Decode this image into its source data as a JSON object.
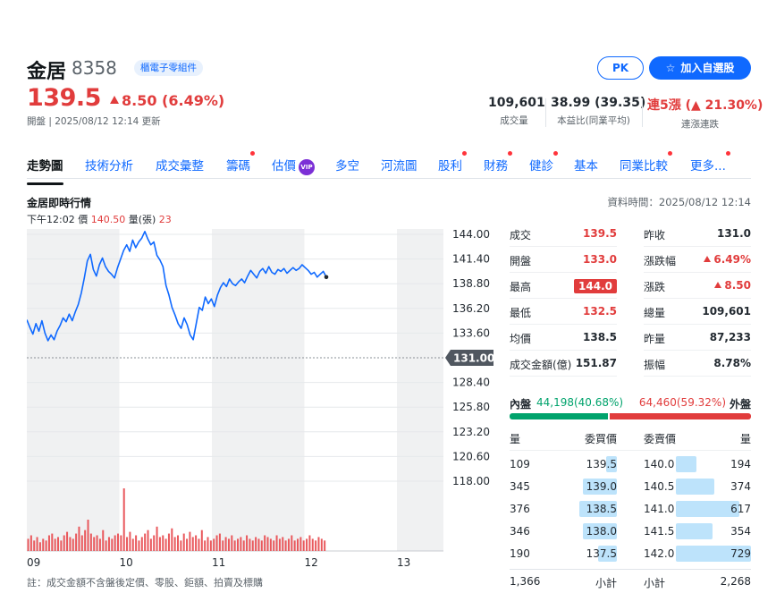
{
  "header": {
    "name": "金居",
    "code": "8358",
    "sector": "櫃電子零組件",
    "price": "139.5",
    "change": "8.50 (6.49%)",
    "status": "開盤 | 2025/08/12 12:14 更新",
    "pk_label": "PK",
    "watch_label": "加入自選股",
    "stats": [
      {
        "value": "109,601",
        "label": "成交量"
      },
      {
        "value": "38.99 (39.35)",
        "label": "本益比(同業平均)"
      },
      {
        "value": "連5漲 (▲ 21.30%)",
        "label": "連漲連跌"
      }
    ]
  },
  "tabs": [
    {
      "label": "走勢圖",
      "active": true,
      "dot": false
    },
    {
      "label": "技術分析",
      "dot": false
    },
    {
      "label": "成交彙整",
      "dot": false
    },
    {
      "label": "籌碼",
      "dot": true
    },
    {
      "label": "估價",
      "dot": false,
      "vip": "VIP"
    },
    {
      "label": "多空",
      "dot": false
    },
    {
      "label": "河流圖",
      "dot": false
    },
    {
      "label": "股利",
      "dot": true
    },
    {
      "label": "財務",
      "dot": true
    },
    {
      "label": "健診",
      "dot": true
    },
    {
      "label": "基本",
      "dot": false
    },
    {
      "label": "同業比較",
      "dot": true
    },
    {
      "label": "更多...",
      "dot": true
    }
  ],
  "chart_section": {
    "title": "金居即時行情",
    "data_time": "資料時間：2025/08/12 12:14",
    "legend_time": "下午12:02",
    "legend_price_label": "價",
    "legend_price": "140.50",
    "legend_vol_label": "量(張)",
    "legend_vol": "23",
    "footnote": "註：成交金額不含盤後定價、零股、鉅額、拍賣及標購"
  },
  "chart_data": {
    "type": "line",
    "reference_price": "131.00",
    "y_ticks": [
      "144.00",
      "141.40",
      "138.80",
      "136.20",
      "133.60",
      "128.40",
      "125.80",
      "123.20",
      "120.60",
      "118.00"
    ],
    "x_ticks": [
      "09",
      "10",
      "11",
      "12",
      "13"
    ],
    "ylim": [
      118.0,
      144.0
    ],
    "color": "#0f69ff",
    "price_series": [
      135.0,
      134.2,
      133.5,
      134.6,
      133.8,
      134.9,
      133.6,
      132.8,
      133.4,
      132.9,
      133.8,
      134.4,
      135.2,
      134.8,
      135.6,
      134.9,
      135.8,
      136.6,
      137.8,
      139.4,
      141.2,
      141.9,
      140.3,
      139.6,
      140.8,
      141.5,
      140.6,
      140.1,
      139.8,
      139.4,
      140.5,
      141.4,
      142.3,
      142.9,
      142.2,
      143.4,
      142.6,
      143.2,
      143.6,
      144.3,
      143.5,
      142.9,
      143.2,
      141.8,
      141.3,
      140.6,
      138.6,
      137.6,
      136.3,
      135.5,
      134.6,
      134.1,
      135.2,
      134.5,
      133.4,
      132.9,
      134.6,
      136.3,
      136.0,
      137.4,
      136.7,
      137.2,
      136.4,
      137.6,
      138.4,
      138.9,
      138.5,
      139.3,
      138.8,
      138.6,
      139.0,
      139.3,
      138.9,
      139.6,
      140.2,
      139.8,
      139.4,
      140.1,
      140.4,
      139.9,
      140.6,
      140.0,
      139.8,
      140.3,
      140.1,
      140.4,
      139.9,
      140.2,
      140.5,
      140.2,
      140.4,
      140.8,
      140.5,
      140.2,
      139.8,
      140.0,
      139.5,
      139.8,
      140.1,
      139.5
    ],
    "volume_series": [
      7,
      9,
      6,
      8,
      5,
      7,
      6,
      9,
      10,
      7,
      8,
      6,
      9,
      11,
      8,
      7,
      10,
      14,
      9,
      12,
      18,
      10,
      8,
      9,
      7,
      12,
      6,
      8,
      7,
      9,
      10,
      9,
      36,
      8,
      11,
      7,
      9,
      6,
      8,
      10,
      12,
      7,
      9,
      14,
      8,
      9,
      7,
      10,
      13,
      8,
      9,
      6,
      10,
      7,
      11,
      8,
      9,
      7,
      12,
      6,
      8,
      6,
      7,
      9,
      10,
      6,
      8,
      7,
      9,
      6,
      7,
      8,
      6,
      9,
      7,
      6,
      8,
      7,
      6,
      9,
      8,
      7,
      6,
      9,
      7,
      8,
      6,
      7,
      9,
      6,
      7,
      8,
      6,
      7,
      9,
      7,
      6,
      8,
      7,
      6
    ]
  },
  "quote_table": {
    "left": [
      {
        "label": "成交",
        "value": "139.5",
        "color": "up"
      },
      {
        "label": "開盤",
        "value": "133.0",
        "color": "up"
      },
      {
        "label": "最高",
        "value": "144.0",
        "color": "badge"
      },
      {
        "label": "最低",
        "value": "132.5",
        "color": "up"
      },
      {
        "label": "均價",
        "value": "138.5",
        "color": "plain"
      },
      {
        "label": "成交金額(億)",
        "value": "151.87",
        "color": "plain"
      }
    ],
    "right": [
      {
        "label": "昨收",
        "value": "131.0",
        "color": "plain"
      },
      {
        "label": "漲跌幅",
        "value": "6.49%",
        "color": "up-tri"
      },
      {
        "label": "漲跌",
        "value": "8.50",
        "color": "up-tri"
      },
      {
        "label": "總量",
        "value": "109,601",
        "color": "plain"
      },
      {
        "label": "昨量",
        "value": "87,233",
        "color": "plain"
      },
      {
        "label": "振幅",
        "value": "8.78%",
        "color": "plain"
      }
    ]
  },
  "inout": {
    "in_label": "內盤",
    "in_value": "44,198(40.68%)",
    "in_ratio": 0.4068,
    "out_value": "64,460(59.32%)",
    "out_label": "外盤"
  },
  "order_book": {
    "headers": {
      "bid_qty": "量",
      "bid_price": "委買價",
      "ask_price": "委賣價",
      "ask_qty": "量"
    },
    "bids": [
      {
        "qty": "109",
        "price": "139.5",
        "ratio": 0.15
      },
      {
        "qty": "345",
        "price": "139.0",
        "ratio": 0.47
      },
      {
        "qty": "376",
        "price": "138.5",
        "ratio": 0.52
      },
      {
        "qty": "346",
        "price": "138.0",
        "ratio": 0.47
      },
      {
        "qty": "190",
        "price": "137.5",
        "ratio": 0.26
      }
    ],
    "asks": [
      {
        "price": "140.0",
        "qty": "194",
        "ratio": 0.27
      },
      {
        "price": "140.5",
        "qty": "374",
        "ratio": 0.51
      },
      {
        "price": "141.0",
        "qty": "617",
        "ratio": 0.85
      },
      {
        "price": "141.5",
        "qty": "354",
        "ratio": 0.49
      },
      {
        "price": "142.0",
        "qty": "729",
        "ratio": 1.0
      }
    ],
    "bid_total": "1,366",
    "bid_total_label": "小計",
    "ask_total_label": "小計",
    "ask_total": "2,268"
  }
}
